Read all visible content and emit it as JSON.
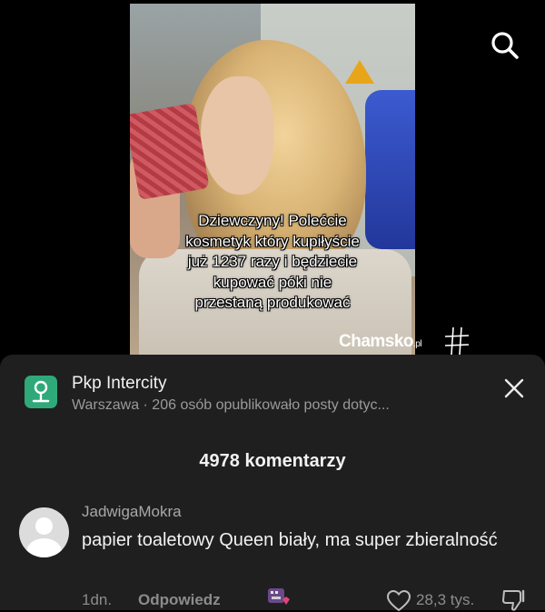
{
  "video": {
    "caption_lines": [
      "Dziewczyny! Polećcie",
      "kosmetyk który kupiłyście",
      "już 1237 razy i będziecie",
      "kupować póki nie",
      "przestaną produkować"
    ]
  },
  "watermark": {
    "brand": "Chamsko",
    "suffix": ".pl"
  },
  "location": {
    "title": "Pkp Intercity",
    "subtitle": "Warszawa · 206 osób opublikowało posty dotyc..."
  },
  "comments_header": {
    "count_label": "4978 komentarzy"
  },
  "comment": {
    "username": "JadwigaMokra",
    "text": "papier toaletowy Queen biały, ma super zbieralność",
    "time": "1dn.",
    "reply_label": "Odpowiedz",
    "likes": "28,3 tys."
  },
  "icons": {
    "search": "search-icon",
    "close": "close-icon",
    "location": "location-pin-icon",
    "like": "heart-icon",
    "dislike": "dislike-icon"
  },
  "colors": {
    "sheet_bg": "#1f1f1f",
    "location_badge": "#2fa97a"
  }
}
